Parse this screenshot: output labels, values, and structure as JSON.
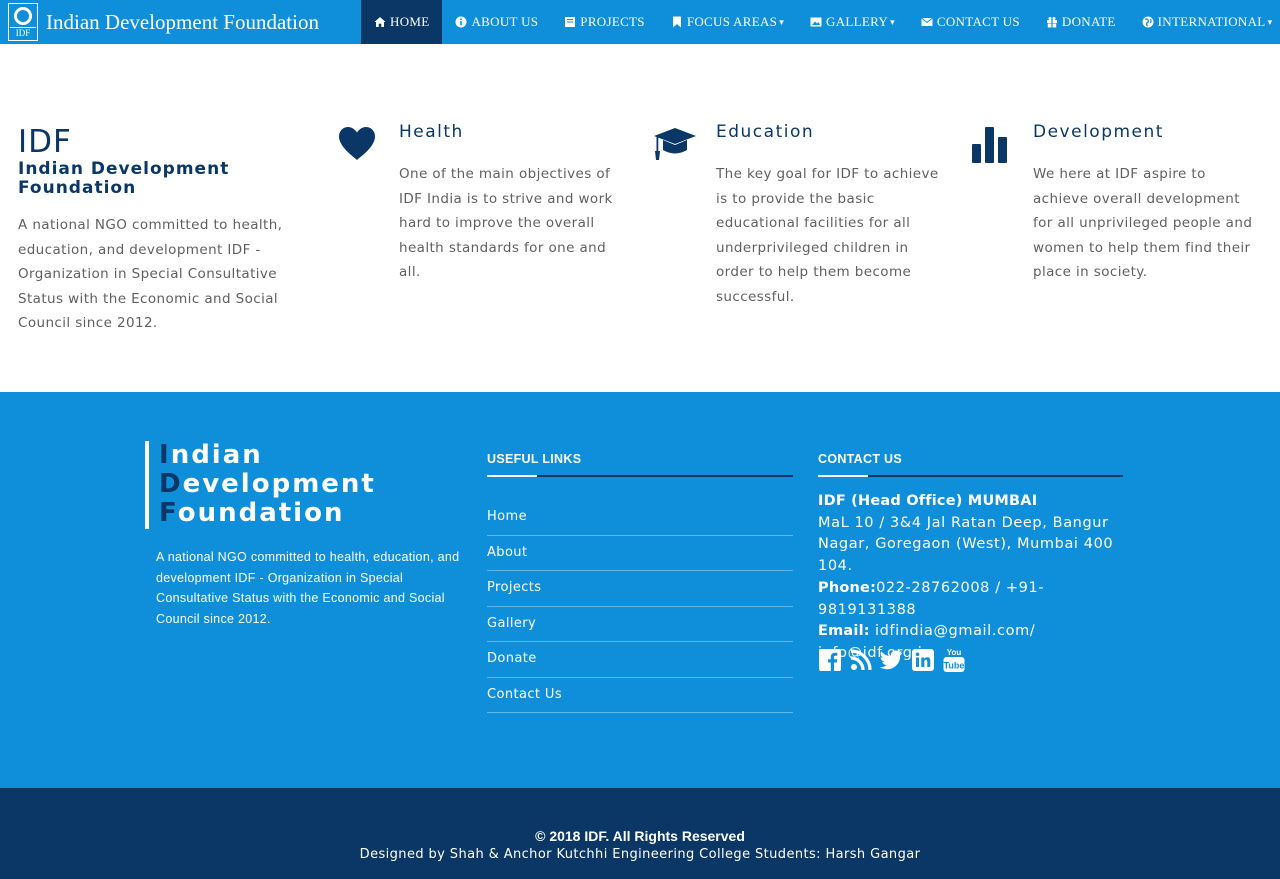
{
  "brand": {
    "logo_text": "IDF",
    "name": "Indian Development Foundation"
  },
  "nav": [
    {
      "label": "HOME",
      "icon": "home-icon",
      "active": true
    },
    {
      "label": "ABOUT US",
      "icon": "info-icon"
    },
    {
      "label": "PROJECTS",
      "icon": "book-icon"
    },
    {
      "label": "FOCUS AREAS",
      "icon": "bookmark-icon",
      "dropdown": true
    },
    {
      "label": "GALLERY",
      "icon": "picture-icon",
      "dropdown": true
    },
    {
      "label": "CONTACT US",
      "icon": "envelope-icon"
    },
    {
      "label": "DONATE",
      "icon": "gift-icon"
    },
    {
      "label": "INTERNATIONAL",
      "icon": "globe-icon",
      "dropdown": true
    }
  ],
  "intro": {
    "title": "IDF",
    "subtitle": "Indian Development Foundation",
    "description": "A national NGO committed to health, education, and development IDF - Organization in Special Consultative Status with the Economic and Social Council since 2012."
  },
  "features": [
    {
      "title": "Health",
      "icon": "heart-icon",
      "text": "One of the main objectives of IDF India is to strive and work hard to improve the overall health standards for one and all."
    },
    {
      "title": "Education",
      "icon": "graduation-cap-icon",
      "text": "The key goal for IDF to achieve is to provide the basic educational facilities for all underprivileged children in order to help them become successful."
    },
    {
      "title": "Development",
      "icon": "bar-chart-icon",
      "text": "We here at IDF aspire to achieve overall development for all unprivileged people and women to help them find their place in society."
    }
  ],
  "footer": {
    "logo_lines": [
      {
        "first": "I",
        "rest": "ndian"
      },
      {
        "first": "D",
        "rest": "evelopment"
      },
      {
        "first": "F",
        "rest": "oundation"
      }
    ],
    "description": "A national NGO committed to health, education, and development IDF - Organization in Special Consultative Status with the Economic and Social Council since 2012.",
    "useful_links_heading": "USEFUL LINKS",
    "links": [
      "Home",
      "About",
      "Projects",
      "Gallery",
      "Donate",
      "Contact Us"
    ],
    "contact_heading": "CONTACT US",
    "office": "IDF (Head Office) MUMBAI",
    "address": "MaL 10 / 3&4 Jal Ratan Deep, Bangur Nagar, Goregaon (West), Mumbai 400 104.",
    "phone_label": "Phone:",
    "phone": "022-28762008 / +91-9819131388",
    "email_label": "Email:",
    "email": "idfindia@gmail.com/ info@idf.org.in",
    "socials": [
      "facebook-icon",
      "rss-icon",
      "twitter-icon",
      "linkedin-icon",
      "youtube-icon"
    ]
  },
  "bottom": {
    "copyright": "© 2018 IDF. All Rights Reserved",
    "designed_by": "Designed by Shah & Anchor Kutchhi Engineering College Students: Harsh Gangar"
  },
  "colors": {
    "nav_blue": "#0f8fd9",
    "dark_navy": "#0a3766",
    "text_grey": "#606060"
  }
}
